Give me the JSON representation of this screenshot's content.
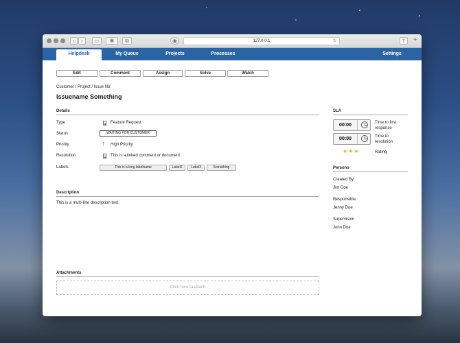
{
  "browser": {
    "url": "127.0.0.1"
  },
  "nav": {
    "tabs": [
      {
        "label": "Helpdesk",
        "active": true
      },
      {
        "label": "My Queue",
        "active": false
      },
      {
        "label": "Projects",
        "active": false
      },
      {
        "label": "Processes",
        "active": false
      }
    ],
    "settings": "Settings"
  },
  "actions": {
    "edit": "Edit",
    "comment": "Comment",
    "assign": "Assign",
    "solve": "Solve",
    "watch": "Watch"
  },
  "breadcrumb": "Customer / Project / Issue No",
  "issue_title": "Issuename Something",
  "details": {
    "heading": "Details",
    "type_label": "Type",
    "type_value": "Feature Request",
    "status_label": "Status",
    "status_value": "WAITING FOR CUSTOMER",
    "priority_label": "Priority",
    "priority_value": "High Priority",
    "resolution_label": "Resolution",
    "resolution_value": "This is a linked comment or document",
    "labels_label": "Labels",
    "labels": [
      "This is a long labelname",
      "Label2",
      "Label3",
      "Something"
    ]
  },
  "description": {
    "heading": "Description",
    "text": "This is a multi-line description text."
  },
  "attachments": {
    "heading": "Attachments",
    "placeholder": "Click here to attach"
  },
  "sla": {
    "heading": "SLA",
    "first_response_time": "00:00",
    "first_response_label_1": "Time to first",
    "first_response_label_2": "response",
    "resolution_time": "00:00",
    "resolution_label_1": "Time to",
    "resolution_label_2": "resolution",
    "rating_stars": "★★★",
    "rating_label": "Rating",
    "star_color": "#e2b21d"
  },
  "persons": {
    "heading": "Persons",
    "created_by_label": "Created By",
    "created_by": "Jim Doe",
    "responsible_label": "Responsible",
    "responsible": "Jenny Doe",
    "supervision_label": "Supervision",
    "supervision": "John Doe"
  },
  "colors": {
    "nav_blue": "#2a64a4",
    "priority_red": "#c0392b"
  }
}
